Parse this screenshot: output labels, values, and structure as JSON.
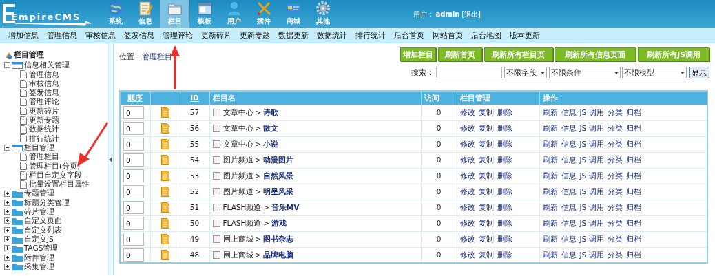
{
  "header": {
    "logo": "EmpireCMS",
    "modules": [
      {
        "label": "系统",
        "selected": false
      },
      {
        "label": "信息",
        "selected": false
      },
      {
        "label": "栏目",
        "selected": true
      },
      {
        "label": "模板",
        "selected": false
      },
      {
        "label": "用户",
        "selected": false
      },
      {
        "label": "插件",
        "selected": false
      },
      {
        "label": "商城",
        "selected": false
      },
      {
        "label": "其他",
        "selected": false
      }
    ],
    "user_label": "用户：",
    "username": "admin",
    "logout": "[退出]"
  },
  "menu": [
    "增加信息",
    "管理信息",
    "审核信息",
    "签发信息",
    "管理评论",
    "更新碎片",
    "更新专题",
    "数据更新",
    "数据统计",
    "排行统计",
    "后台首页",
    "网站首页",
    "后台地图",
    "版本更新"
  ],
  "sidebar": {
    "title": "栏目管理",
    "tree": [
      {
        "label": "信息相关管理",
        "expanded": true,
        "children": [
          {
            "label": "管理信息"
          },
          {
            "label": "审核信息"
          },
          {
            "label": "签发信息"
          },
          {
            "label": "管理评论"
          },
          {
            "label": "更新碎片"
          },
          {
            "label": "更新专题"
          },
          {
            "label": "数据统计"
          },
          {
            "label": "排行统计"
          }
        ]
      },
      {
        "label": "栏目管理",
        "expanded": true,
        "children": [
          {
            "label": "管理栏目"
          },
          {
            "label": "管理栏目(分页)"
          },
          {
            "label": "栏目自定义字段"
          },
          {
            "label": "批量设置栏目属性"
          }
        ]
      },
      {
        "label": "专题管理",
        "expanded": false
      },
      {
        "label": "标题分类管理",
        "expanded": false
      },
      {
        "label": "碎片管理",
        "expanded": false
      },
      {
        "label": "自定义页面",
        "expanded": false
      },
      {
        "label": "自定义列表",
        "expanded": false
      },
      {
        "label": "自定义JS",
        "expanded": false
      },
      {
        "label": "TAGS管理",
        "expanded": false
      },
      {
        "label": "附件管理",
        "expanded": false
      },
      {
        "label": "采集管理",
        "expanded": false
      }
    ]
  },
  "location": {
    "label": "位置：",
    "link": "管理栏目"
  },
  "action_buttons": [
    "增加栏目",
    "刷新首页",
    "刷新所有栏目页",
    "刷新所有信息页面",
    "刷新所有JS调用"
  ],
  "search": {
    "label": "搜索：",
    "selects": [
      "不限字段",
      "不限条件",
      "不限模型"
    ],
    "button": "显示"
  },
  "table": {
    "columns": [
      "顺序",
      "ID",
      "栏目名",
      "访问",
      "栏目管理",
      "操作"
    ],
    "rows": [
      {
        "order": "0",
        "id": "57",
        "checked": false,
        "parent": "文章中心",
        "sep": ">",
        "name": "诗歌",
        "visits": "0",
        "manage": [
          "修改",
          "复制",
          "删除"
        ],
        "ops": [
          "刷新",
          "信息",
          "JS 调用",
          "分类",
          "归档"
        ]
      },
      {
        "order": "0",
        "id": "56",
        "checked": false,
        "parent": "文章中心",
        "sep": ">",
        "name": "散文",
        "visits": "0",
        "manage": [
          "修改",
          "复制",
          "删除"
        ],
        "ops": [
          "刷新",
          "信息",
          "JS 调用",
          "分类",
          "归档"
        ]
      },
      {
        "order": "0",
        "id": "55",
        "checked": false,
        "parent": "文章中心",
        "sep": ">",
        "name": "小说",
        "visits": "0",
        "manage": [
          "修改",
          "复制",
          "删除"
        ],
        "ops": [
          "刷新",
          "信息",
          "JS 调用",
          "分类",
          "归档"
        ]
      },
      {
        "order": "0",
        "id": "54",
        "checked": false,
        "parent": "图片频道",
        "sep": ">",
        "name": "动漫图片",
        "visits": "0",
        "manage": [
          "修改",
          "复制",
          "删除"
        ],
        "ops": [
          "刷新",
          "信息",
          "JS 调用",
          "分类",
          "归档"
        ]
      },
      {
        "order": "0",
        "id": "53",
        "checked": false,
        "parent": "图片频道",
        "sep": ">",
        "name": "自然风景",
        "visits": "0",
        "manage": [
          "修改",
          "复制",
          "删除"
        ],
        "ops": [
          "刷新",
          "信息",
          "JS 调用",
          "分类",
          "归档"
        ]
      },
      {
        "order": "0",
        "id": "52",
        "checked": false,
        "parent": "图片频道",
        "sep": ">",
        "name": "明星风采",
        "visits": "0",
        "manage": [
          "修改",
          "复制",
          "删除"
        ],
        "ops": [
          "刷新",
          "信息",
          "JS 调用",
          "分类",
          "归档"
        ]
      },
      {
        "order": "0",
        "id": "51",
        "checked": false,
        "parent": "FLASH频道",
        "sep": ">",
        "name": "音乐MV",
        "visits": "0",
        "manage": [
          "修改",
          "复制",
          "删除"
        ],
        "ops": [
          "刷新",
          "信息",
          "JS 调用",
          "分类",
          "归档"
        ]
      },
      {
        "order": "0",
        "id": "50",
        "checked": false,
        "parent": "FLASH频道",
        "sep": ">",
        "name": "游戏",
        "visits": "0",
        "manage": [
          "修改",
          "复制",
          "删除"
        ],
        "ops": [
          "刷新",
          "信息",
          "JS 调用",
          "分类",
          "归档"
        ]
      },
      {
        "order": "0",
        "id": "49",
        "checked": false,
        "parent": "网上商城",
        "sep": ">",
        "name": "图书杂志",
        "visits": "0",
        "manage": [
          "修改",
          "复制",
          "删除"
        ],
        "ops": [
          "刷新",
          "信息",
          "JS 调用",
          "分类",
          "归档"
        ]
      },
      {
        "order": "0",
        "id": "48",
        "checked": false,
        "parent": "网上商城",
        "sep": ">",
        "name": "品牌电脑",
        "visits": "0",
        "manage": [
          "修改",
          "复制",
          "删除"
        ],
        "ops": [
          "刷新",
          "信息",
          "JS 调用",
          "分类",
          "归档"
        ]
      }
    ]
  }
}
